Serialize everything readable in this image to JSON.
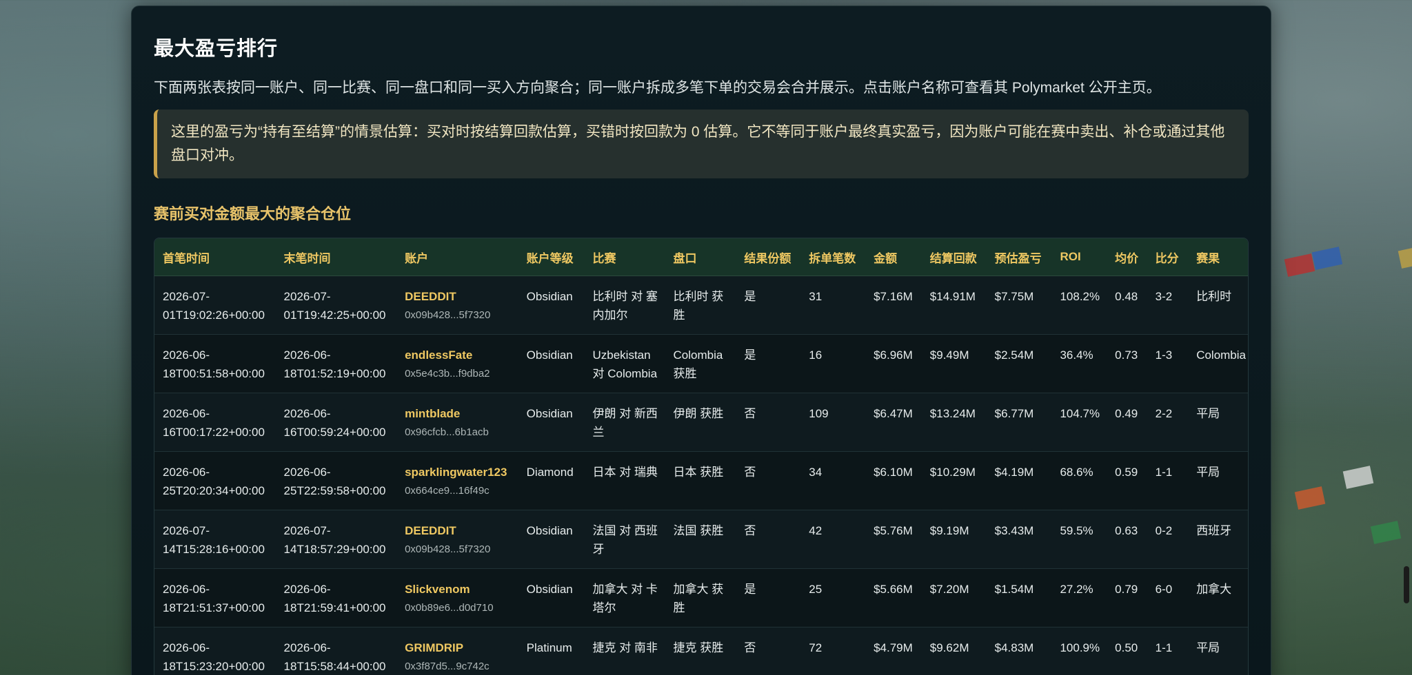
{
  "section": {
    "title": "最大盈亏排行",
    "description": "下面两张表按同一账户、同一比赛、同一盘口和同一买入方向聚合；同一账户拆成多笔下单的交易会合并展示。点击账户名称可查看其 Polymarket 公开主页。",
    "note": "这里的盈亏为“持有至结算”的情景估算：买对时按结算回款估算，买错时按回款为 0 估算。它不等同于账户最终真实盈亏，因为账户可能在赛中卖出、补仓或通过其他盘口对冲。",
    "subtitle": "赛前买对金额最大的聚合仓位"
  },
  "table": {
    "headers": [
      "首笔时间",
      "末笔时间",
      "账户",
      "账户等级",
      "比赛",
      "盘口",
      "结果份额",
      "拆单笔数",
      "金额",
      "结算回款",
      "预估盈亏",
      "ROI",
      "均价",
      "比分",
      "赛果"
    ],
    "rows": [
      {
        "first": "2026-07-01T19:02:26+00:00",
        "last": "2026-07-01T19:42:25+00:00",
        "account": "DEEDDIT",
        "address": "0x09b428...5f7320",
        "tier": "Obsidian",
        "match": "比利时 对 塞内加尔",
        "market": "比利时 获胜",
        "result": "是",
        "splits": "31",
        "amount": "$7.16M",
        "payout": "$14.91M",
        "pnl": "$7.75M",
        "roi": "108.2%",
        "avg": "0.48",
        "score": "3-2",
        "outcome": "比利时"
      },
      {
        "first": "2026-06-18T00:51:58+00:00",
        "last": "2026-06-18T01:52:19+00:00",
        "account": "endlessFate",
        "address": "0x5e4c3b...f9dba2",
        "tier": "Obsidian",
        "match": "Uzbekistan 对 Colombia",
        "market": "Colombia 获胜",
        "result": "是",
        "splits": "16",
        "amount": "$6.96M",
        "payout": "$9.49M",
        "pnl": "$2.54M",
        "roi": "36.4%",
        "avg": "0.73",
        "score": "1-3",
        "outcome": "Colombia"
      },
      {
        "first": "2026-06-16T00:17:22+00:00",
        "last": "2026-06-16T00:59:24+00:00",
        "account": "mintblade",
        "address": "0x96cfcb...6b1acb",
        "tier": "Obsidian",
        "match": "伊朗 对 新西兰",
        "market": "伊朗 获胜",
        "result": "否",
        "splits": "109",
        "amount": "$6.47M",
        "payout": "$13.24M",
        "pnl": "$6.77M",
        "roi": "104.7%",
        "avg": "0.49",
        "score": "2-2",
        "outcome": "平局"
      },
      {
        "first": "2026-06-25T20:20:34+00:00",
        "last": "2026-06-25T22:59:58+00:00",
        "account": "sparklingwater123",
        "address": "0x664ce9...16f49c",
        "tier": "Diamond",
        "match": "日本 对 瑞典",
        "market": "日本 获胜",
        "result": "否",
        "splits": "34",
        "amount": "$6.10M",
        "payout": "$10.29M",
        "pnl": "$4.19M",
        "roi": "68.6%",
        "avg": "0.59",
        "score": "1-1",
        "outcome": "平局"
      },
      {
        "first": "2026-07-14T15:28:16+00:00",
        "last": "2026-07-14T18:57:29+00:00",
        "account": "DEEDDIT",
        "address": "0x09b428...5f7320",
        "tier": "Obsidian",
        "match": "法国 对 西班牙",
        "market": "法国 获胜",
        "result": "否",
        "splits": "42",
        "amount": "$5.76M",
        "payout": "$9.19M",
        "pnl": "$3.43M",
        "roi": "59.5%",
        "avg": "0.63",
        "score": "0-2",
        "outcome": "西班牙"
      },
      {
        "first": "2026-06-18T21:51:37+00:00",
        "last": "2026-06-18T21:59:41+00:00",
        "account": "Slickvenom",
        "address": "0x0b89e6...d0d710",
        "tier": "Obsidian",
        "match": "加拿大 对 卡塔尔",
        "market": "加拿大 获胜",
        "result": "是",
        "splits": "25",
        "amount": "$5.66M",
        "payout": "$7.20M",
        "pnl": "$1.54M",
        "roi": "27.2%",
        "avg": "0.79",
        "score": "6-0",
        "outcome": "加拿大"
      },
      {
        "first": "2026-06-18T15:23:20+00:00",
        "last": "2026-06-18T15:58:44+00:00",
        "account": "GRIMDRIP",
        "address": "0x3f87d5...9c742c",
        "tier": "Platinum",
        "match": "捷克 对 南非",
        "market": "捷克 获胜",
        "result": "否",
        "splits": "72",
        "amount": "$4.79M",
        "payout": "$9.62M",
        "pnl": "$4.83M",
        "roi": "100.9%",
        "avg": "0.50",
        "score": "1-1",
        "outcome": "平局"
      }
    ]
  },
  "decor": {
    "flag_colors": [
      "#c8a640",
      "#c02b2b",
      "#2b5db8",
      "#e0e0e0",
      "#2f8a4a",
      "#d85a2b"
    ]
  }
}
